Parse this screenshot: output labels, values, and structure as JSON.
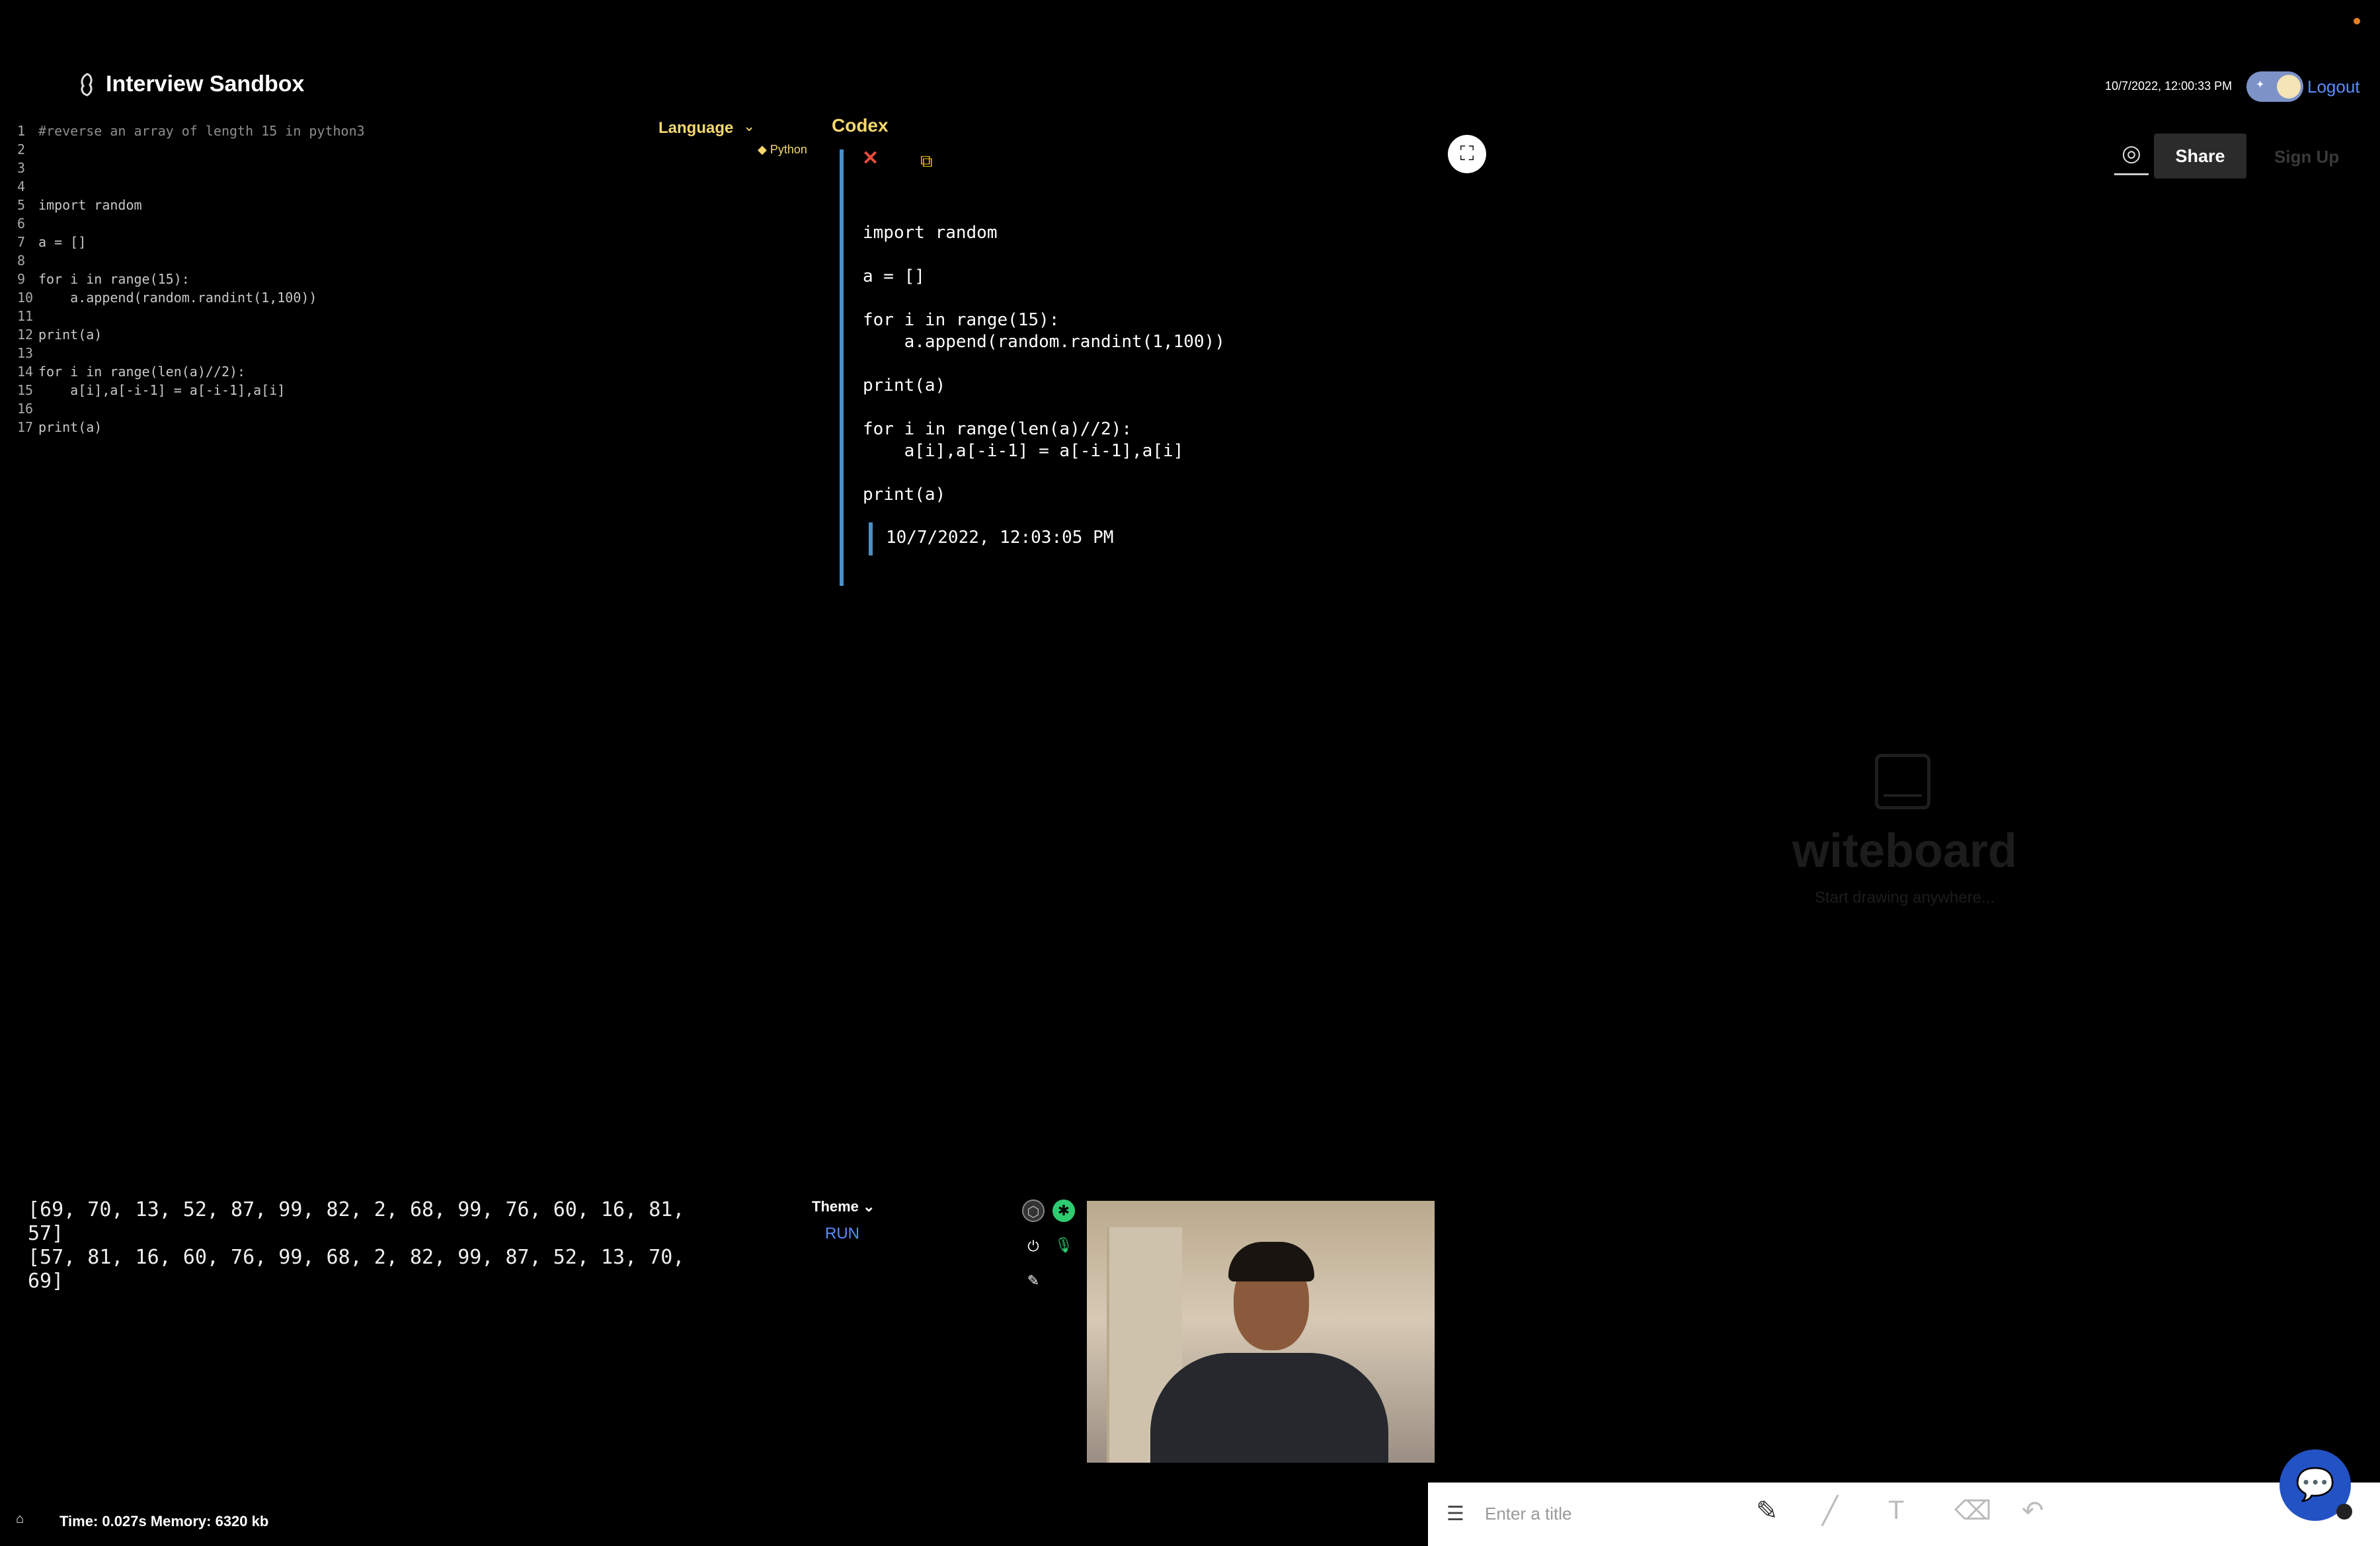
{
  "header": {
    "title": "Interview Sandbox",
    "datetime": "10/7/2022, 12:00:33 PM",
    "logout_label": "Logout",
    "theme_toggle_icon": "moon-stars"
  },
  "editor": {
    "lines": [
      {
        "n": "1",
        "code": "#reverse an array of length 15 in python3"
      },
      {
        "n": "2",
        "code": ""
      },
      {
        "n": "3",
        "code": ""
      },
      {
        "n": "4",
        "code": ""
      },
      {
        "n": "5",
        "code": "import random"
      },
      {
        "n": "6",
        "code": ""
      },
      {
        "n": "7",
        "code": "a = []"
      },
      {
        "n": "8",
        "code": ""
      },
      {
        "n": "9",
        "code": "for i in range(15):"
      },
      {
        "n": "10",
        "code": "    a.append(random.randint(1,100))"
      },
      {
        "n": "11",
        "code": ""
      },
      {
        "n": "12",
        "code": "print(a)"
      },
      {
        "n": "13",
        "code": ""
      },
      {
        "n": "14",
        "code": "for i in range(len(a)//2):"
      },
      {
        "n": "15",
        "code": "    a[i],a[-i-1] = a[-i-1],a[i]"
      },
      {
        "n": "16",
        "code": ""
      },
      {
        "n": "17",
        "code": "print(a)"
      }
    ],
    "language_label": "Language",
    "language_value": "Python",
    "theme_label": "Theme",
    "run_label": "RUN"
  },
  "codex": {
    "title": "Codex",
    "code": "import random\n\na = []\n\nfor i in range(15):\n    a.append(random.randint(1,100))\n\nprint(a)\n\nfor i in range(len(a)//2):\n    a[i],a[-i-1] = a[-i-1],a[i]\n\nprint(a)",
    "timestamp": "10/7/2022, 12:03:05 PM"
  },
  "output": {
    "text": "[69, 70, 13, 52, 87, 99, 82, 2, 68, 99, 76, 60, 16, 81,\n57]\n[57, 81, 16, 60, 76, 99, 68, 2, 82, 99, 87, 52, 13, 70,\n69]"
  },
  "toolbar": {
    "share_label": "Share",
    "signup_label": "Sign Up"
  },
  "whiteboard": {
    "brand": "witeboard",
    "tagline": "Start drawing anywhere...",
    "title_placeholder": "Enter a title"
  },
  "status": {
    "text": "Time: 0.027s Memory: 6320 kb"
  },
  "colors": {
    "accent_yellow": "#f5d76e",
    "link_blue": "#5b8dff",
    "codex_bar": "#4a90c8",
    "chat_blue": "#2352c4"
  }
}
